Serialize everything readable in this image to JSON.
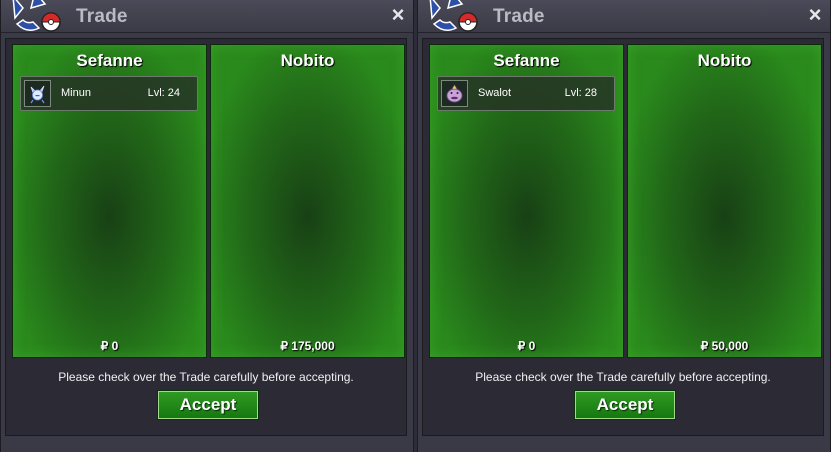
{
  "windows": [
    {
      "title": "Trade",
      "left": {
        "name": "Sefanne",
        "pokemon": {
          "name": "Minun",
          "level": "Lvl: 24"
        },
        "money": "₽ 0"
      },
      "right": {
        "name": "Nobito",
        "money": "₽ 175,000"
      },
      "notice": "Please check over the Trade carefully before accepting.",
      "accept_label": "Accept"
    },
    {
      "title": "Trade",
      "left": {
        "name": "Sefanne",
        "pokemon": {
          "name": "Swalot",
          "level": "Lvl: 28"
        },
        "money": "₽ 0"
      },
      "right": {
        "name": "Nobito",
        "money": "₽ 50,000"
      },
      "notice": "Please check over the Trade carefully before accepting.",
      "accept_label": "Accept"
    }
  ],
  "icons": {
    "close": "×",
    "logo": "trade-logo-icon",
    "pokemon_left": "minun-icon",
    "pokemon_right": "swalot-icon"
  },
  "colors": {
    "panel_green": "#2a8a1c",
    "button_green": "#1f8a18",
    "title_text": "#b9bac4",
    "window_bg": "#3a3946"
  }
}
